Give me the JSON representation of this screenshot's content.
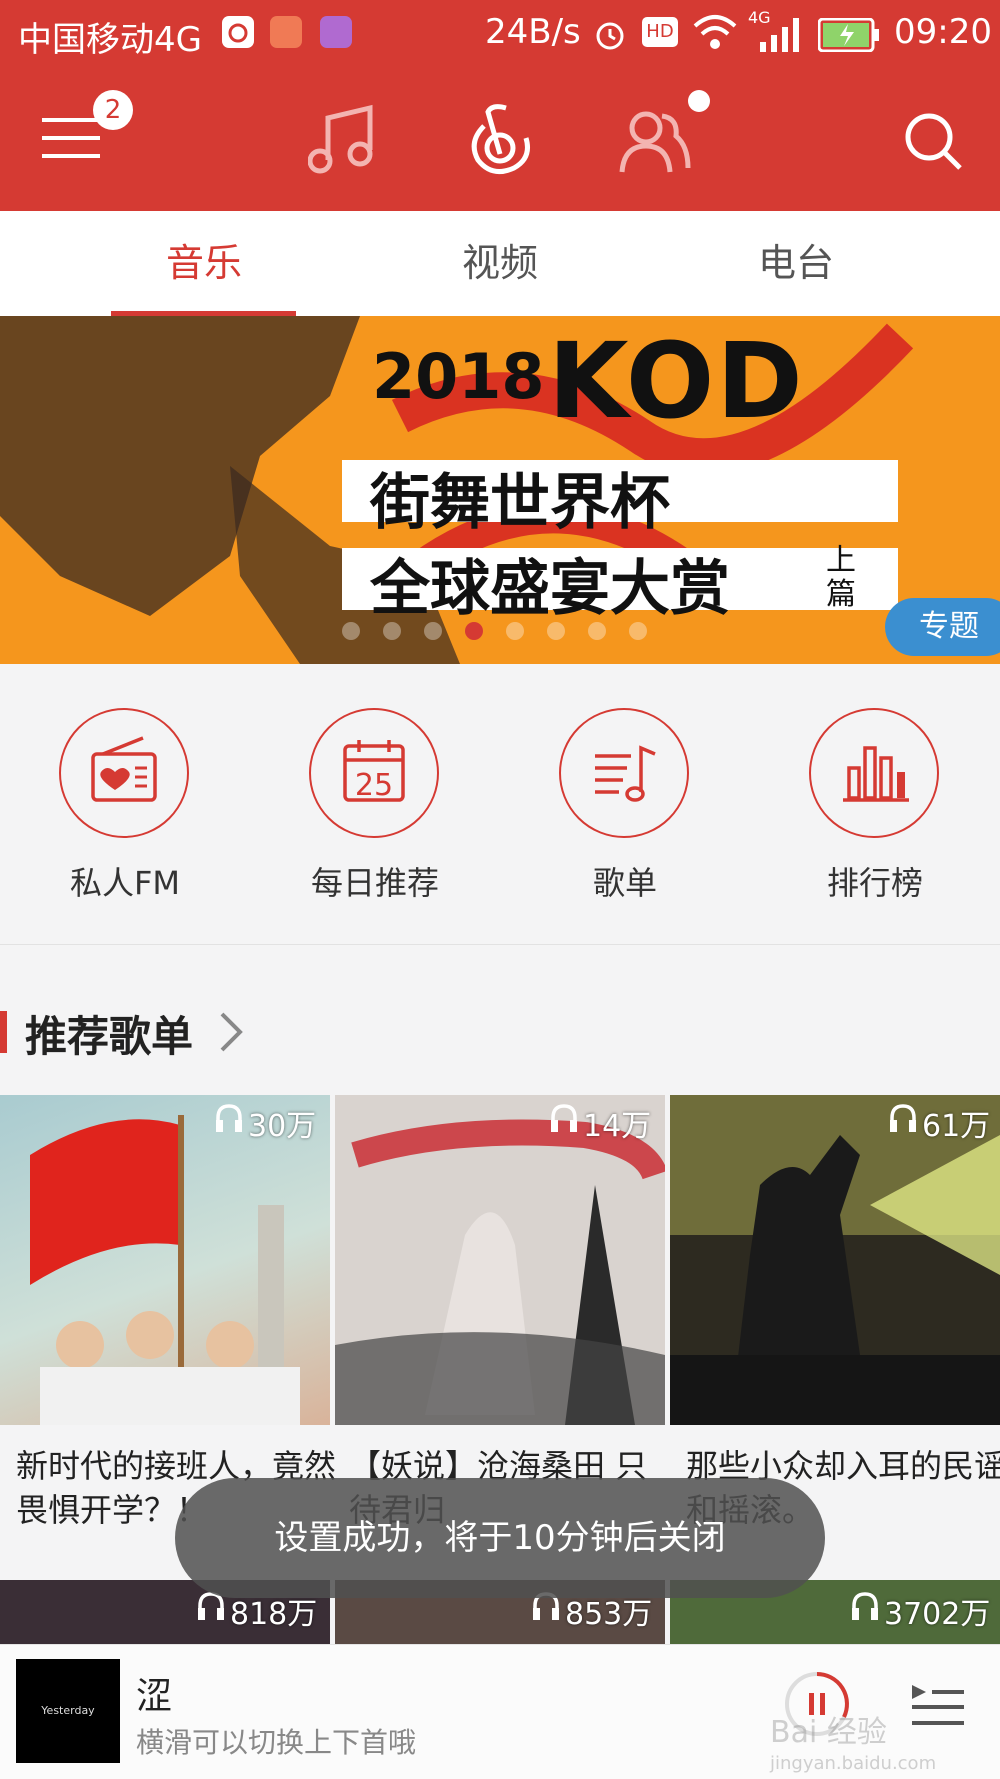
{
  "status_bar": {
    "carrier": "中国移动4G",
    "speed": "24B/s",
    "hd": "HD",
    "net": "4G",
    "time": "09:20"
  },
  "header": {
    "menu_badge": "2",
    "icons": [
      "menu-icon",
      "music-note-icon",
      "netease-logo-icon",
      "friends-icon",
      "search-icon"
    ]
  },
  "tabs": [
    {
      "label": "音乐",
      "active": true
    },
    {
      "label": "视频",
      "active": false
    },
    {
      "label": "电台",
      "active": false
    }
  ],
  "banner": {
    "year": "2018",
    "brand": "KOD",
    "line1": "街舞世界杯",
    "line2": "全球盛宴大赏",
    "part": "上篇",
    "tag": "专题",
    "page_count": 8,
    "active_page": 4
  },
  "quick_entries": [
    {
      "label": "私人FM",
      "icon": "radio-icon"
    },
    {
      "label": "每日推荐",
      "icon": "calendar-icon",
      "day": "25"
    },
    {
      "label": "歌单",
      "icon": "playlist-icon"
    },
    {
      "label": "排行榜",
      "icon": "chart-icon"
    }
  ],
  "section": {
    "title": "推荐歌单"
  },
  "playlists": [
    {
      "plays": "30万",
      "title": "新时代的接班人，竟然畏惧开学？！"
    },
    {
      "plays": "14万",
      "title": "【妖说】沧海桑田 只待君归"
    },
    {
      "plays": "61万",
      "title": "那些小众却入耳的民谣和摇滚。"
    }
  ],
  "playlists_row2": [
    {
      "plays": "818万"
    },
    {
      "plays": "853万"
    },
    {
      "plays": "3702万"
    }
  ],
  "toast": "设置成功，将于10分钟后关闭",
  "player": {
    "cover_text": "Yesterday",
    "song": "涩",
    "hint": "横滑可以切换上下首哦"
  },
  "watermark": {
    "main": "Bai 经验",
    "sub": "jingyan.baidu.com"
  },
  "colors": {
    "accent": "#d53a33",
    "banner_bg": "#f5961d",
    "tag": "#3b8fd0"
  }
}
